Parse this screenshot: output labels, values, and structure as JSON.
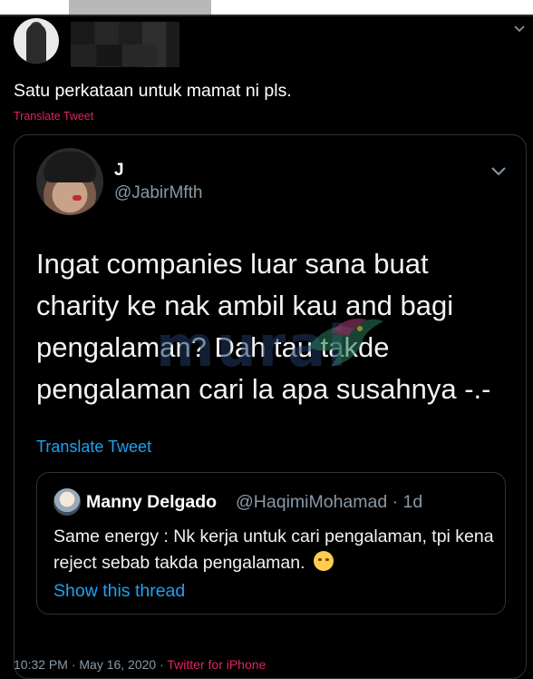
{
  "tweet": {
    "text": "Satu perkataan untuk mamat ni pls.",
    "translate_label": "Translate Tweet"
  },
  "quoted": {
    "name": "J",
    "handle": "@JabirMfth",
    "text": "Ingat companies luar sana buat charity ke nak ambil kau and bagi pengalaman? Dah tau takde pengalaman cari la apa susahnya -.-",
    "translate_label": "Translate Tweet",
    "watermark": "murai"
  },
  "inner": {
    "name": "Manny Delgado",
    "handle_date": "@HaqimiMohamad · 1d",
    "text": "Same energy : Nk kerja untuk cari pengalaman, tpi kena reject sebab takda pengalaman.",
    "emoji_icon": "woozy-face-icon",
    "show_thread": "Show this thread"
  },
  "meta": {
    "time_date": "10:32 PM · May 16, 2020 · ",
    "source": "Twitter for iPhone"
  },
  "colors": {
    "background": "#000000",
    "link_blue": "#1da1f2",
    "translate_red": "#e0245e",
    "muted": "#8899a6",
    "border": "#2f3336"
  }
}
